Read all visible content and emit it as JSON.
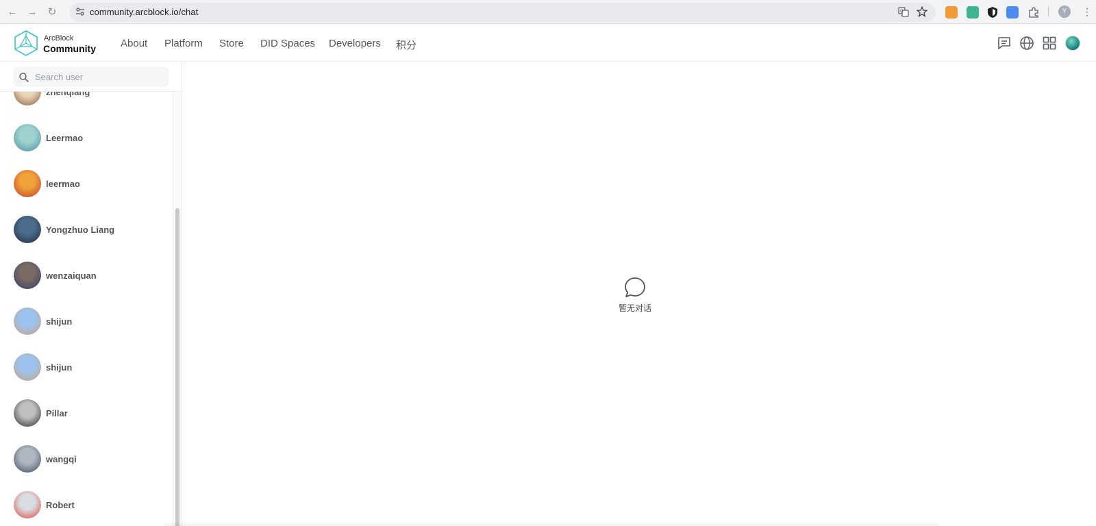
{
  "browser": {
    "url": "community.arcblock.io/chat",
    "profile_initial": "Y"
  },
  "header": {
    "brand_top": "ArcBlock",
    "brand_bottom": "Community",
    "nav": [
      "About",
      "Platform",
      "Store",
      "DID Spaces",
      "Developers",
      "积分"
    ]
  },
  "sidebar": {
    "search_placeholder": "Search user",
    "users": [
      {
        "name": "zhenqiang",
        "avatar_colors": [
          "#e9d6b8",
          "#8a5a3a"
        ]
      },
      {
        "name": "Leermao",
        "avatar_colors": [
          "#9fd2cf",
          "#4a8fa0"
        ]
      },
      {
        "name": "leermao",
        "avatar_colors": [
          "#f0a23a",
          "#c0392b"
        ]
      },
      {
        "name": "Yongzhuo Liang",
        "avatar_colors": [
          "#4b6c8c",
          "#1f2a35"
        ]
      },
      {
        "name": "wenzaiquan",
        "avatar_colors": [
          "#7a6a64",
          "#2d3a6b"
        ]
      },
      {
        "name": "shijun",
        "avatar_colors": [
          "#9cc3ef",
          "#c9a27e"
        ]
      },
      {
        "name": "shijun",
        "avatar_colors": [
          "#9cc3ef",
          "#c9a27e"
        ]
      },
      {
        "name": "Pillar",
        "avatar_colors": [
          "#bfbfbf",
          "#2b2b2b"
        ]
      },
      {
        "name": "wangqi",
        "avatar_colors": [
          "#aeb7c2",
          "#3f4a57"
        ]
      },
      {
        "name": "Robert",
        "avatar_colors": [
          "#d8dde3",
          "#e0443b"
        ]
      }
    ]
  },
  "main": {
    "empty_text": "暂无对话"
  },
  "icons": {
    "back": "arrow-left-icon",
    "forward": "arrow-right-icon",
    "reload": "reload-icon",
    "translate": "translate-icon",
    "bookmark": "star-icon",
    "messages": "message-icon",
    "language": "globe-icon",
    "apps": "grid-icon"
  }
}
